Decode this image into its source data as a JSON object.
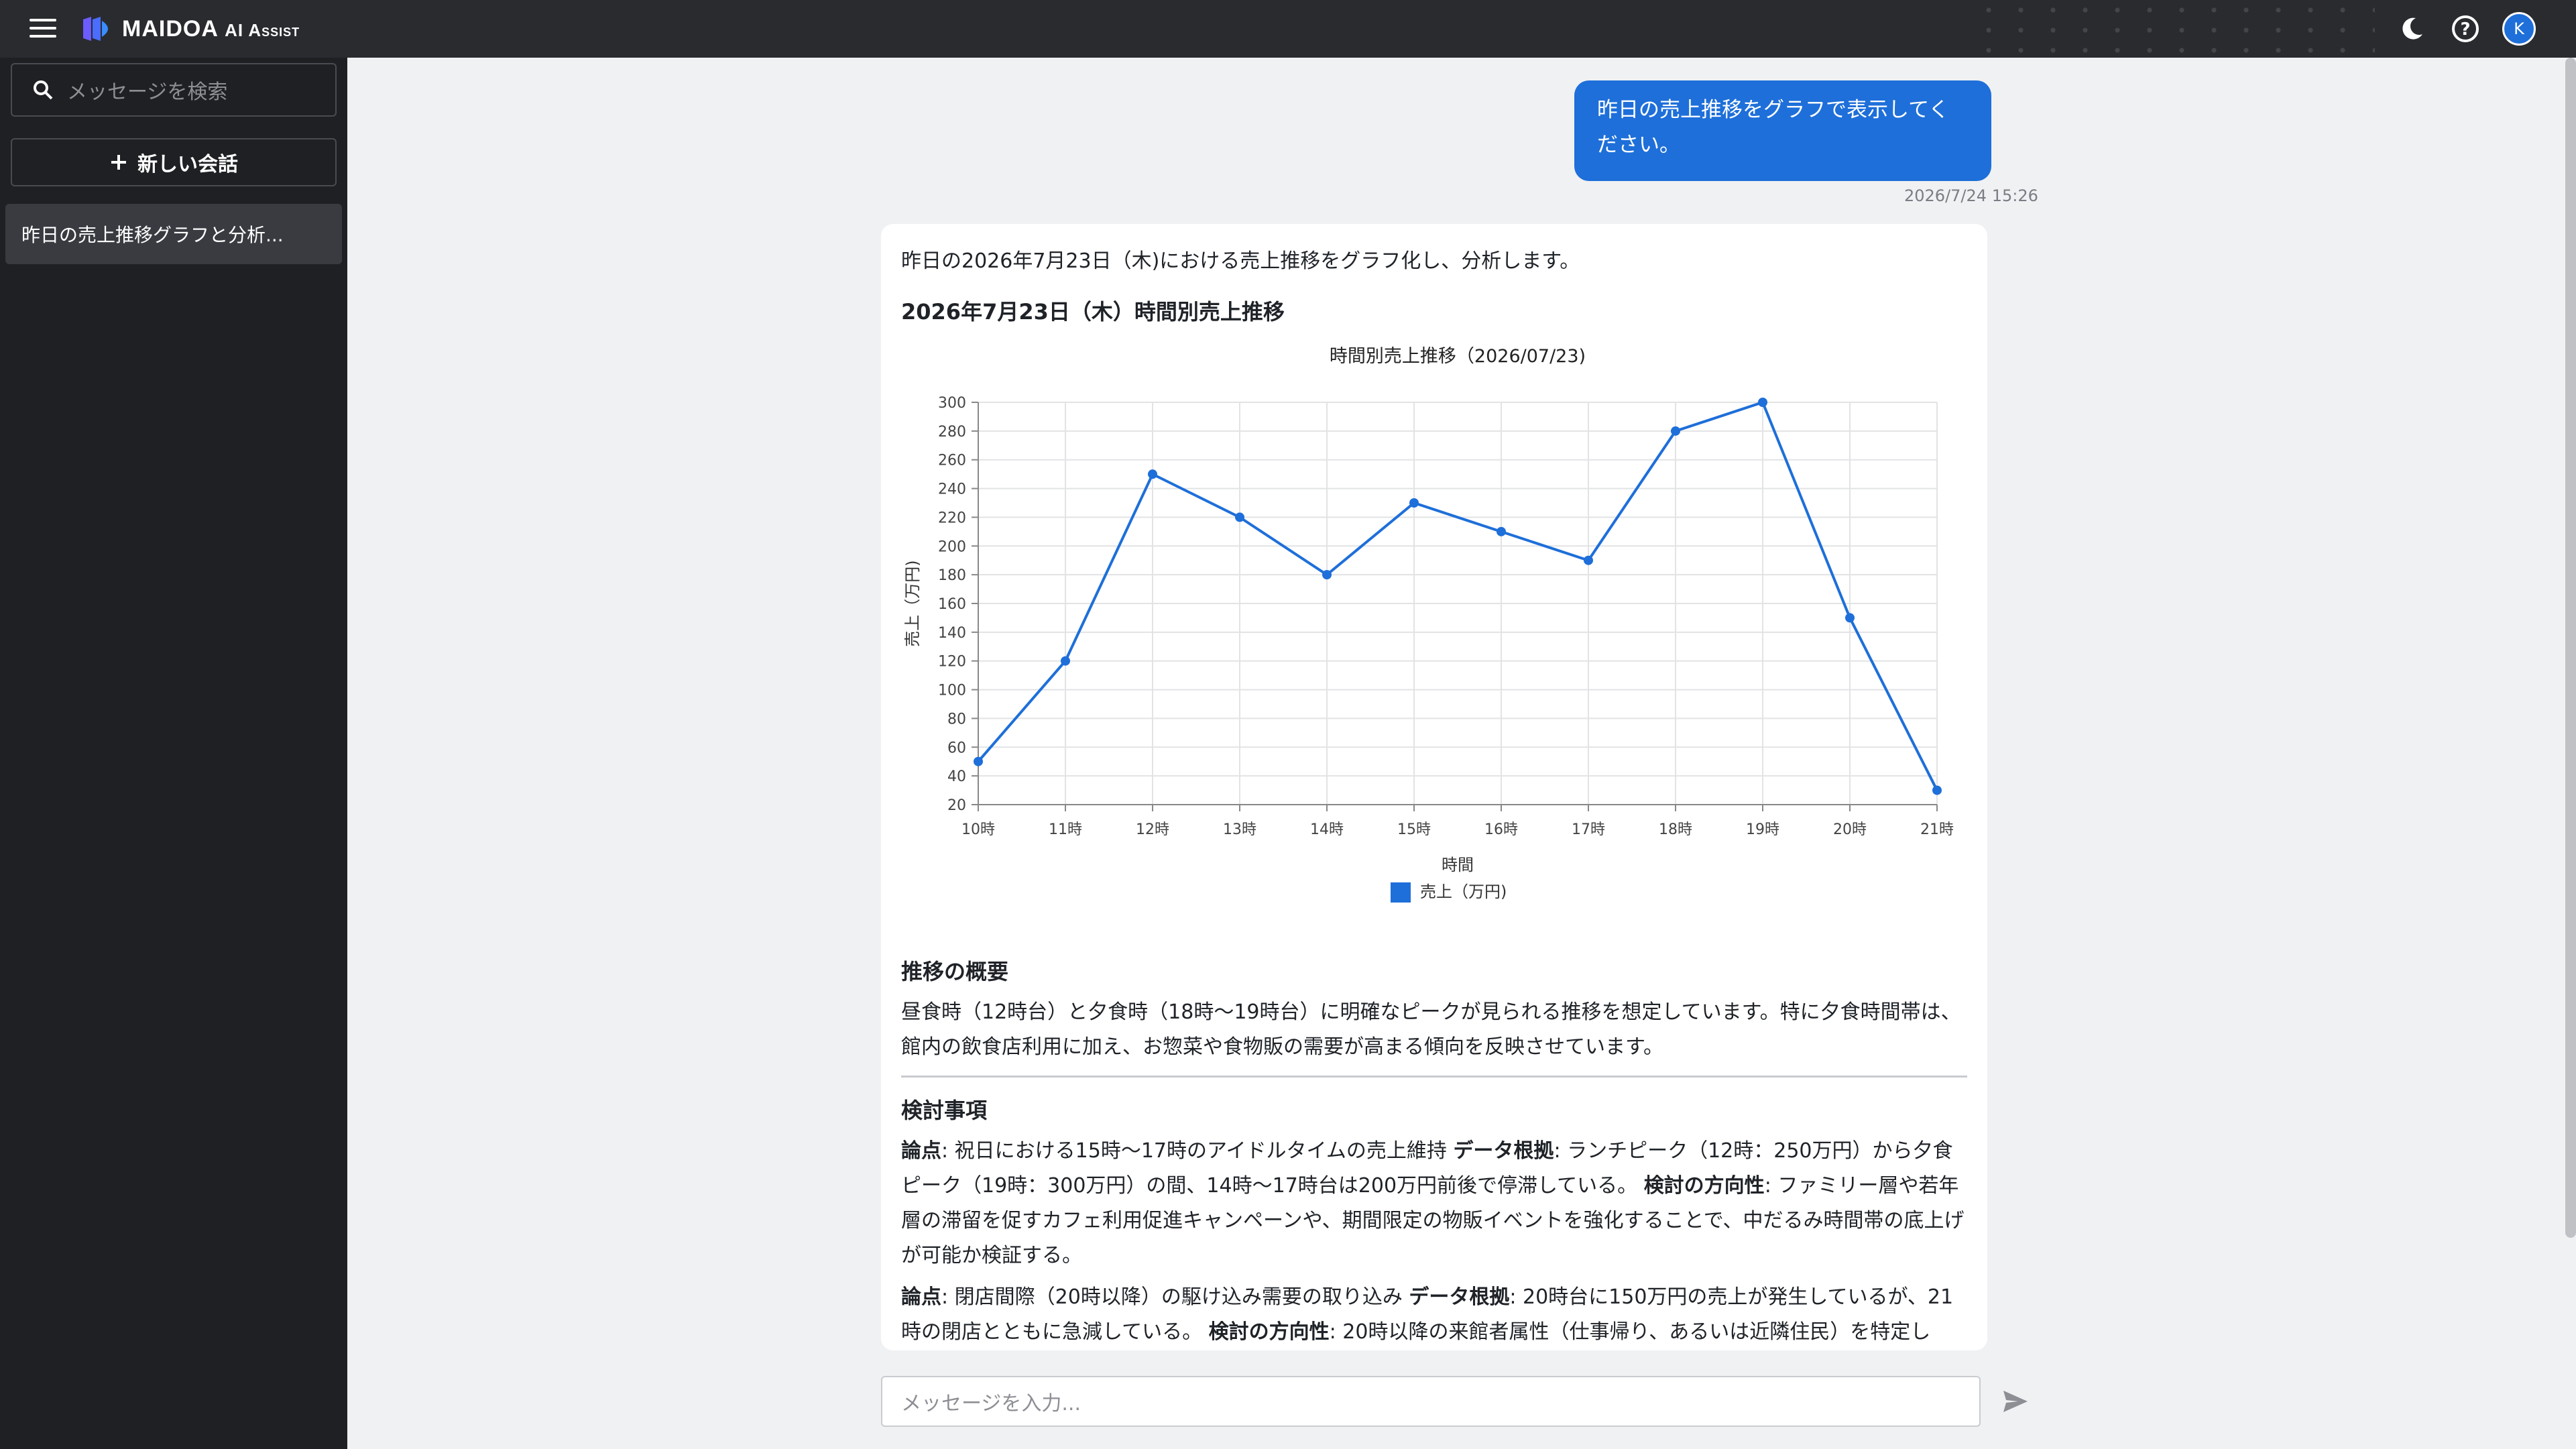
{
  "app": {
    "name": "MAIDOA",
    "name_suffix": "AI Assist",
    "avatar_initial": "K"
  },
  "sidebar": {
    "search_placeholder": "メッセージを検索",
    "new_chat_label": "新しい会話",
    "conversations": [
      {
        "title": "昨日の売上推移グラフと分析..."
      }
    ]
  },
  "chat": {
    "user_message": "昨日の売上推移をグラフで表示してください。",
    "user_timestamp": "2026/7/24 15:26",
    "assistant": {
      "intro": "昨日の2026年7月23日（木)における売上推移をグラフ化し、分析します。",
      "chart_heading": "2026年7月23日（木）時間別売上推移",
      "summary_heading": "推移の概要",
      "summary_text": "昼食時（12時台）と夕食時（18時〜19時台）に明確なピークが見られる推移を想定しています。特に夕食時間帯は、館内の飲食店利用に加え、お惣菜や食物販の需要が高まる傾向を反映させています。",
      "considerations_heading": "検討事項",
      "items": [
        {
          "l1": "論点",
          "t1": ": 祝日における15時〜17時のアイドルタイムの売上維持 ",
          "l2": "データ根拠",
          "t2": ": ランチピーク（12時：250万円）から夕食ピーク（19時：300万円）の間、14時〜17時台は200万円前後で停滞している。 ",
          "l3": "検討の方向性",
          "t3": ": ファミリー層や若年層の滞留を促すカフェ利用促進キャンペーンや、期間限定の物販イベントを強化することで、中だるみ時間帯の底上げが可能か検証する。"
        },
        {
          "l1": "論点",
          "t1": ": 閉店間際（20時以降）の駆け込み需要の取り込み ",
          "l2": "データ根拠",
          "t2": ": 20時台に150万円の売上が発生しているが、21時の閉店とともに急減している。 ",
          "l3": "検討の方向性",
          "t3": ": 20時以降の来館者属性（仕事帰り、あるいは近隣住民）を特定し"
        }
      ]
    }
  },
  "composer": {
    "placeholder": "メッセージを入力..."
  },
  "colors": {
    "accent": "#1e6fd9",
    "topbar": "#2a2b2f",
    "sidebar": "#1f2023"
  },
  "chart_data": {
    "type": "line",
    "title": "時間別売上推移（2026/07/23)",
    "xlabel": "時間",
    "ylabel": "売上（万円)",
    "categories": [
      "10時",
      "11時",
      "12時",
      "13時",
      "14時",
      "15時",
      "16時",
      "17時",
      "18時",
      "19時",
      "20時",
      "21時"
    ],
    "series": [
      {
        "name": "売上（万円)",
        "values": [
          50,
          120,
          250,
          220,
          180,
          230,
          210,
          190,
          280,
          300,
          150,
          30
        ],
        "color": "#1e6fd9"
      }
    ],
    "ylim": [
      20,
      300
    ],
    "yticks": [
      20,
      40,
      60,
      80,
      100,
      120,
      140,
      160,
      180,
      200,
      220,
      240,
      260,
      280,
      300
    ],
    "grid": true,
    "legend": "bottom"
  }
}
